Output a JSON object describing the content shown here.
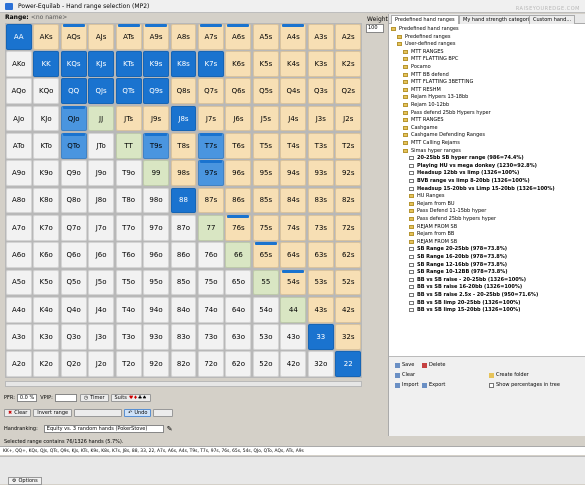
{
  "window": {
    "title": "Power-Equilab - Hand range selection (MP2)"
  },
  "logo_text": "RAISEYOUREDGE.COM",
  "range_label": "Range:",
  "range_name": "<no name>",
  "weight_label": "Weight",
  "weight_value": "100",
  "grid": {
    "rows": [
      [
        "AA",
        "AKs",
        "AQs",
        "AJs",
        "ATs",
        "A9s",
        "A8s",
        "A7s",
        "A6s",
        "A5s",
        "A4s",
        "A3s",
        "A2s"
      ],
      [
        "AKo",
        "KK",
        "KQs",
        "KJs",
        "KTs",
        "K9s",
        "K8s",
        "K7s",
        "K6s",
        "K5s",
        "K4s",
        "K3s",
        "K2s"
      ],
      [
        "AQo",
        "KQo",
        "QQ",
        "QJs",
        "QTs",
        "Q9s",
        "Q8s",
        "Q7s",
        "Q6s",
        "Q5s",
        "Q4s",
        "Q3s",
        "Q2s"
      ],
      [
        "AJo",
        "KJo",
        "QJo",
        "JJ",
        "JTs",
        "J9s",
        "J8s",
        "J7s",
        "J6s",
        "J5s",
        "J4s",
        "J3s",
        "J2s"
      ],
      [
        "ATo",
        "KTo",
        "QTo",
        "JTo",
        "TT",
        "T9s",
        "T8s",
        "T7s",
        "T6s",
        "T5s",
        "T4s",
        "T3s",
        "T2s"
      ],
      [
        "A9o",
        "K9o",
        "Q9o",
        "J9o",
        "T9o",
        "99",
        "98s",
        "97s",
        "96s",
        "95s",
        "94s",
        "93s",
        "92s"
      ],
      [
        "A8o",
        "K8o",
        "Q8o",
        "J8o",
        "T8o",
        "98o",
        "88",
        "87s",
        "86s",
        "85s",
        "84s",
        "83s",
        "82s"
      ],
      [
        "A7o",
        "K7o",
        "Q7o",
        "J7o",
        "T7o",
        "97o",
        "87o",
        "77",
        "76s",
        "75s",
        "74s",
        "73s",
        "72s"
      ],
      [
        "A6o",
        "K6o",
        "Q6o",
        "J6o",
        "T6o",
        "96o",
        "86o",
        "76o",
        "66",
        "65s",
        "64s",
        "63s",
        "62s"
      ],
      [
        "A5o",
        "K5o",
        "Q5o",
        "J5o",
        "T5o",
        "95o",
        "85o",
        "75o",
        "65o",
        "55",
        "54s",
        "53s",
        "52s"
      ],
      [
        "A4o",
        "K4o",
        "Q4o",
        "J4o",
        "T4o",
        "94o",
        "84o",
        "74o",
        "64o",
        "54o",
        "44",
        "43s",
        "42s"
      ],
      [
        "A3o",
        "K3o",
        "Q3o",
        "J3o",
        "T3o",
        "93o",
        "83o",
        "73o",
        "63o",
        "53o",
        "43o",
        "33",
        "32s"
      ],
      [
        "A2o",
        "K2o",
        "Q2o",
        "J2o",
        "T2o",
        "92o",
        "82o",
        "72o",
        "62o",
        "52o",
        "42o",
        "32o",
        "22"
      ]
    ],
    "selected": [
      "AA",
      "KK",
      "KQs",
      "KJs",
      "KTs",
      "K9s",
      "K8s",
      "K7s",
      "QQ",
      "QJs",
      "QTs",
      "Q9s",
      "J8s",
      "88",
      "33",
      "22"
    ],
    "selected_light": [
      "QJo",
      "QTo",
      "T9s",
      "T7s",
      "97s"
    ],
    "marked": [
      "AA",
      "AQs",
      "ATs",
      "A9s",
      "A7s",
      "A6s",
      "A4s",
      "KQs",
      "KJs",
      "KTs",
      "K9s",
      "K7s",
      "QJo",
      "QTo",
      "T9s",
      "T7s",
      "97s",
      "76s",
      "65s",
      "54s",
      "33"
    ],
    "colors": {
      "selected": "#1a73cf",
      "pair": "#d9e6c3",
      "suited": "#f7dfb4",
      "offsuit": "#f2f2f2"
    }
  },
  "right_panel": {
    "tabs": [
      "Predefined hand ranges",
      "My hand strength categories",
      "Custom hand..."
    ],
    "tree": [
      {
        "label": "Predefined hand ranges",
        "level": 0,
        "bold": false,
        "icon": "folder"
      },
      {
        "label": "Predefined ranges",
        "level": 1,
        "bold": false,
        "icon": "folder"
      },
      {
        "label": "User-defined ranges",
        "level": 1,
        "bold": false,
        "icon": "folder"
      },
      {
        "label": "MTT RANGES",
        "level": 2,
        "bold": false,
        "icon": "folder"
      },
      {
        "label": "MTT FLATTING BPC",
        "level": 2,
        "bold": false,
        "icon": "folder"
      },
      {
        "label": "Pocamo",
        "level": 2,
        "bold": false,
        "icon": "folder"
      },
      {
        "label": "MTT BB defend",
        "level": 2,
        "bold": false,
        "icon": "folder"
      },
      {
        "label": "MTT FLATTING 3BETTING",
        "level": 2,
        "bold": false,
        "icon": "folder"
      },
      {
        "label": "MTT RESHM",
        "level": 2,
        "bold": false,
        "icon": "folder"
      },
      {
        "label": "Rejam Hypers 13-18bb",
        "level": 2,
        "bold": false,
        "icon": "folder"
      },
      {
        "label": "Rejam 10-12bb",
        "level": 2,
        "bold": false,
        "icon": "folder"
      },
      {
        "label": "Pass defend 25bb Hypers hyper",
        "level": 2,
        "bold": false,
        "icon": "folder"
      },
      {
        "label": "MTT RANGES",
        "level": 2,
        "bold": false,
        "icon": "folder"
      },
      {
        "label": "Cashgame",
        "level": 2,
        "bold": false,
        "icon": "folder"
      },
      {
        "label": "Cashgame Defending Ranges",
        "level": 2,
        "bold": false,
        "icon": "folder"
      },
      {
        "label": "MTT Calling Rejams",
        "level": 2,
        "bold": false,
        "icon": "folder"
      },
      {
        "label": "Simas hyper ranges",
        "level": 2,
        "bold": false,
        "icon": "folder"
      },
      {
        "label": "20-25bb SB hyper range (986=74.4%)",
        "level": 3,
        "bold": true,
        "icon": "range"
      },
      {
        "label": "Playing HU vs mega donkey (1230=92.8%)",
        "level": 3,
        "bold": true,
        "icon": "range"
      },
      {
        "label": "Headsup 12bb vs limp (1326=100%)",
        "level": 3,
        "bold": true,
        "icon": "range"
      },
      {
        "label": "BVB range vs limp 8-20bb (1326=100%)",
        "level": 3,
        "bold": true,
        "icon": "range"
      },
      {
        "label": "Headsup 15-20bb vs Limp 15-20bb (1326=100%)",
        "level": 3,
        "bold": true,
        "icon": "range"
      },
      {
        "label": "HU Ranges",
        "level": 3,
        "bold": false,
        "icon": "folder"
      },
      {
        "label": "Rejam from BU",
        "level": 3,
        "bold": false,
        "icon": "folder"
      },
      {
        "label": "Pass Defend 11-15bb hyper",
        "level": 3,
        "bold": false,
        "icon": "folder"
      },
      {
        "label": "Pass defend 25bb hypers hyper",
        "level": 3,
        "bold": false,
        "icon": "folder"
      },
      {
        "label": "REJAM FROM SB",
        "level": 3,
        "bold": false,
        "icon": "folder"
      },
      {
        "label": "Rejam from BB",
        "level": 3,
        "bold": false,
        "icon": "folder"
      },
      {
        "label": "REJAM FROM SB",
        "level": 3,
        "bold": false,
        "icon": "folder"
      },
      {
        "label": "SB Range 20-25bb (978=73.8%)",
        "level": 3,
        "bold": true,
        "icon": "range"
      },
      {
        "label": "SB Range 16-20bb (978=73.8%)",
        "level": 3,
        "bold": true,
        "icon": "range"
      },
      {
        "label": "SB Range 12-16bb (978=73.8%)",
        "level": 3,
        "bold": true,
        "icon": "range"
      },
      {
        "label": "SB Range 10-12BB (978=73.8%)",
        "level": 3,
        "bold": true,
        "icon": "range"
      },
      {
        "label": "BB vs SB raise - 20-25bb (1326=100%)",
        "level": 3,
        "bold": true,
        "icon": "range"
      },
      {
        "label": "BB vs SB raise 16-20bb (1326=100%)",
        "level": 3,
        "bold": true,
        "icon": "range"
      },
      {
        "label": "BB vs SB raise 2.5x - 20-25bb (950=71.6%)",
        "level": 3,
        "bold": true,
        "icon": "range"
      },
      {
        "label": "BB vs SB limp 20-25bb (1326=100%)",
        "level": 3,
        "bold": true,
        "icon": "range"
      },
      {
        "label": "BB vs SB limp 15-20bb (1326=100%)",
        "level": 3,
        "bold": true,
        "icon": "range"
      }
    ],
    "buttons_row1": [
      "Save",
      "Delete"
    ],
    "buttons_row2": [
      "Clear",
      "Create folder"
    ],
    "buttons_row3": [
      "Import",
      "Export"
    ],
    "show_pct_label": "Show percentages in tree"
  },
  "bottom": {
    "pfr_label": "PFR:",
    "pfr_value": "0.0 %",
    "vpip_label": "VPIP:",
    "timer_label": "Timer",
    "suits_label": "Suits",
    "clear_label": "Clear",
    "invert_label": "Invert range",
    "undo_label": "Undo",
    "handranking_label": "Handranking:",
    "handranking_value": "Equity vs. 3 random hands (PokerStove)",
    "selected_text": "Selected range contains 76/1326 hands (5.7%).",
    "hand_list": "KK+, QQ+, KQs, QJs, QTs, Q9s, KJs, KTs, K9s, K8s, K7s, J8s, 88, 33, 22, A7s, A6s, A4s, T9s, T7s, 97s, 76s, 65s, 54s, QJo, QTo, AQs, ATs, A9s"
  },
  "status": {
    "options_label": "Options"
  }
}
